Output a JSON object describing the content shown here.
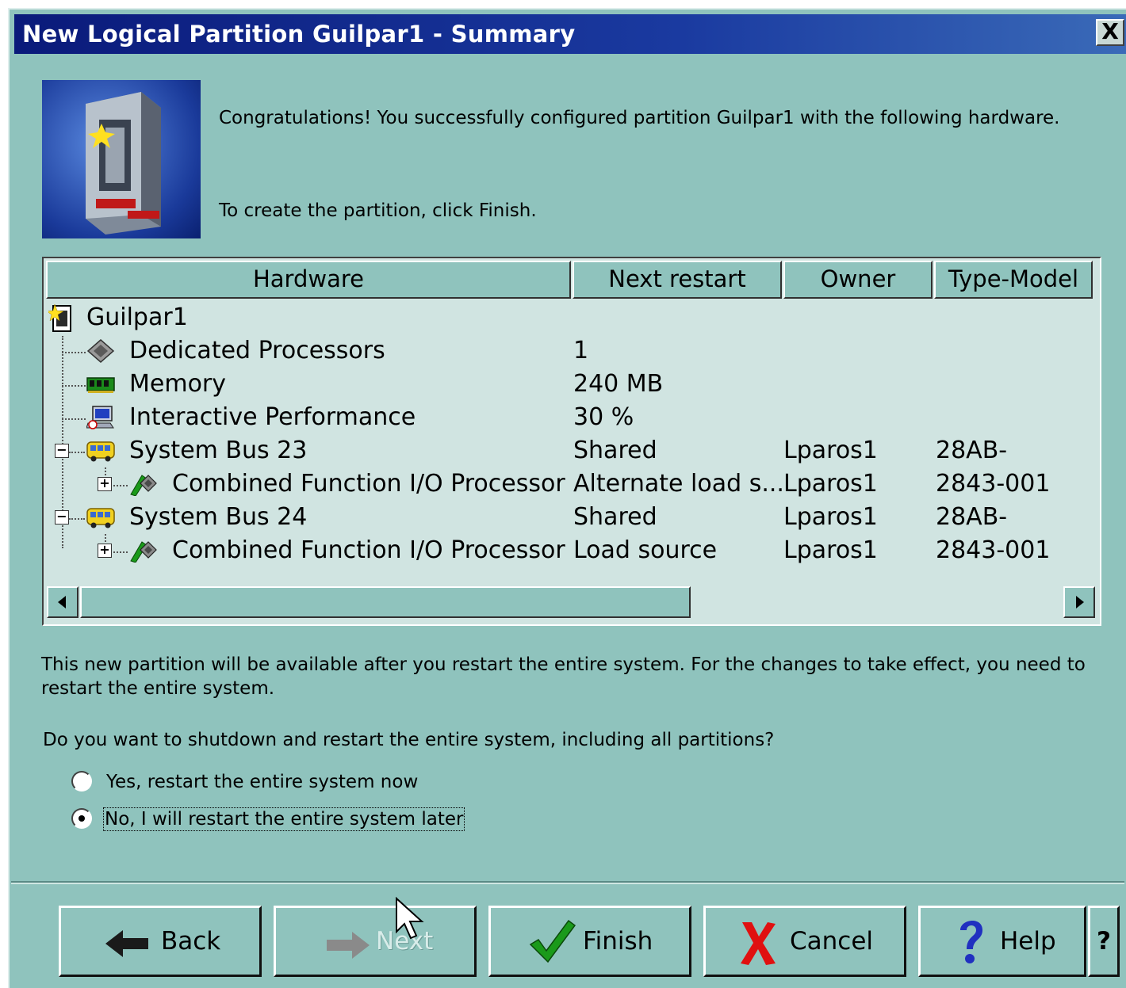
{
  "window": {
    "title": "New Logical Partition Guilpar1 - Summary",
    "close_label": "X"
  },
  "intro": {
    "congrats": "Congratulations! You successfully configured partition Guilpar1 with the following hardware.",
    "instruction": "To create the partition, click Finish."
  },
  "table": {
    "columns": [
      "Hardware",
      "Next restart",
      "Owner",
      "Type-Model"
    ],
    "rows": [
      {
        "hardware": "Guilpar1",
        "next_restart": "",
        "owner": "",
        "type_model": "",
        "icon": "partition-icon"
      },
      {
        "hardware": "Dedicated Processors",
        "next_restart": "1",
        "owner": "",
        "type_model": "",
        "icon": "processor-chip-icon"
      },
      {
        "hardware": "Memory",
        "next_restart": "240 MB",
        "owner": "",
        "type_model": "",
        "icon": "memory-module-icon"
      },
      {
        "hardware": "Interactive Performance",
        "next_restart": "30 %",
        "owner": "",
        "type_model": "",
        "icon": "performance-monitor-icon"
      },
      {
        "hardware": "System Bus 23",
        "next_restart": "Shared",
        "owner": "Lparos1",
        "type_model": "28AB-",
        "icon": "system-bus-icon"
      },
      {
        "hardware": "Combined Function I/O Processor",
        "next_restart": "Alternate load s...",
        "owner": "Lparos1",
        "type_model": "2843-001",
        "icon": "io-processor-icon"
      },
      {
        "hardware": "System Bus 24",
        "next_restart": "Shared",
        "owner": "Lparos1",
        "type_model": "28AB-",
        "icon": "system-bus-icon"
      },
      {
        "hardware": "Combined Function I/O Processor",
        "next_restart": "Load source",
        "owner": "Lparos1",
        "type_model": "2843-001",
        "icon": "io-processor-icon"
      }
    ]
  },
  "notice": {
    "line1": "This new partition will be available after you restart the entire system. For the changes to take effect, you need to",
    "line2": "restart the entire system.",
    "question": "Do you want to shutdown and restart the entire system, including all partitions?"
  },
  "options": {
    "yes_label": "Yes, restart the entire system now",
    "no_label": "No, I will restart the entire system later",
    "selected": "no"
  },
  "buttons": {
    "back": "Back",
    "next": "Next",
    "finish": "Finish",
    "cancel": "Cancel",
    "help": "Help",
    "whats_this": "?"
  },
  "colors": {
    "dialog_bg": "#8fc3bd",
    "title_bar": "#0a1a7a",
    "list_bg": "#d0e4e1"
  }
}
